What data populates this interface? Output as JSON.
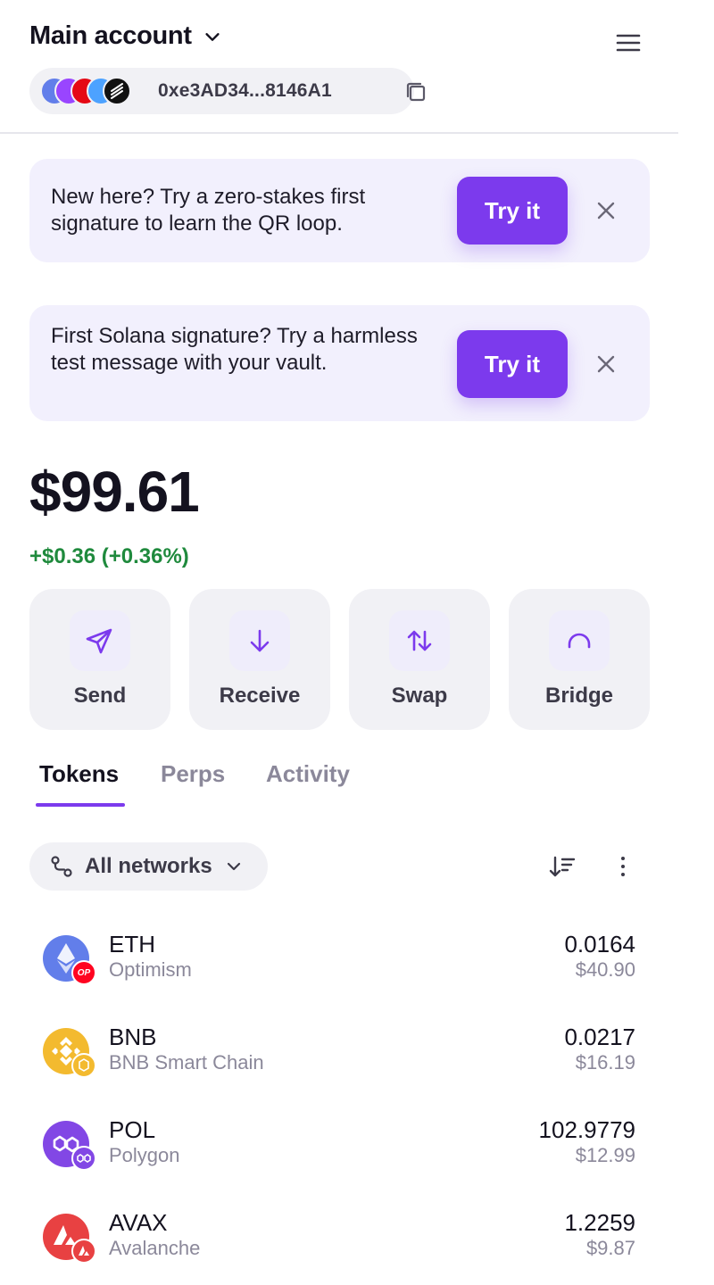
{
  "header": {
    "account_name": "Main account",
    "address": "0xe3AD34...8146A1",
    "chain_icons": [
      {
        "name": "ethereum",
        "color": "#627eea",
        "glyph": "€"
      },
      {
        "name": "solana",
        "color": "#9945ff",
        "glyph": ""
      },
      {
        "name": "tron",
        "color": "#e50915",
        "glyph": "V"
      },
      {
        "name": "sui",
        "color": "#4da2ff",
        "glyph": ""
      },
      {
        "name": "starknet",
        "color": "#111111",
        "glyph": ""
      }
    ]
  },
  "banners": [
    {
      "text": "New here? Try a zero-stakes first signature to learn the QR loop.",
      "button": "Try it"
    },
    {
      "text": "First Solana signature? Try a harmless test message with your vault.",
      "button": "Try it"
    }
  ],
  "portfolio": {
    "balance": "$99.61",
    "change": "+$0.36 (+0.36%)"
  },
  "actions": [
    {
      "label": "Send",
      "icon": "send-icon"
    },
    {
      "label": "Receive",
      "icon": "arrow-down-icon"
    },
    {
      "label": "Swap",
      "icon": "swap-icon"
    },
    {
      "label": "Bridge",
      "icon": "bridge-icon"
    }
  ],
  "tabs": [
    {
      "label": "Tokens",
      "active": true
    },
    {
      "label": "Perps",
      "active": false
    },
    {
      "label": "Activity",
      "active": false
    }
  ],
  "filter": {
    "network_label": "All networks"
  },
  "tokens": [
    {
      "symbol": "ETH",
      "network": "Optimism",
      "amount": "0.0164",
      "usd": "$40.90",
      "logo_color": "#627eea",
      "badge_color": "#ff0420",
      "badge_text": "OP"
    },
    {
      "symbol": "BNB",
      "network": "BNB Smart Chain",
      "amount": "0.0217",
      "usd": "$16.19",
      "logo_color": "#f3ba2f",
      "badge_color": "#f3ba2f",
      "badge_text": ""
    },
    {
      "symbol": "POL",
      "network": "Polygon",
      "amount": "102.9779",
      "usd": "$12.99",
      "logo_color": "#8247e5",
      "badge_color": "#8247e5",
      "badge_text": ""
    },
    {
      "symbol": "AVAX",
      "network": "Avalanche",
      "amount": "1.2259",
      "usd": "$9.87",
      "logo_color": "#e84142",
      "badge_color": "#e84142",
      "badge_text": ""
    }
  ],
  "colors": {
    "accent": "#7c3aed",
    "positive": "#1f8a3d",
    "surface": "#f1f1f5",
    "banner_bg": "#f2f0fd"
  }
}
